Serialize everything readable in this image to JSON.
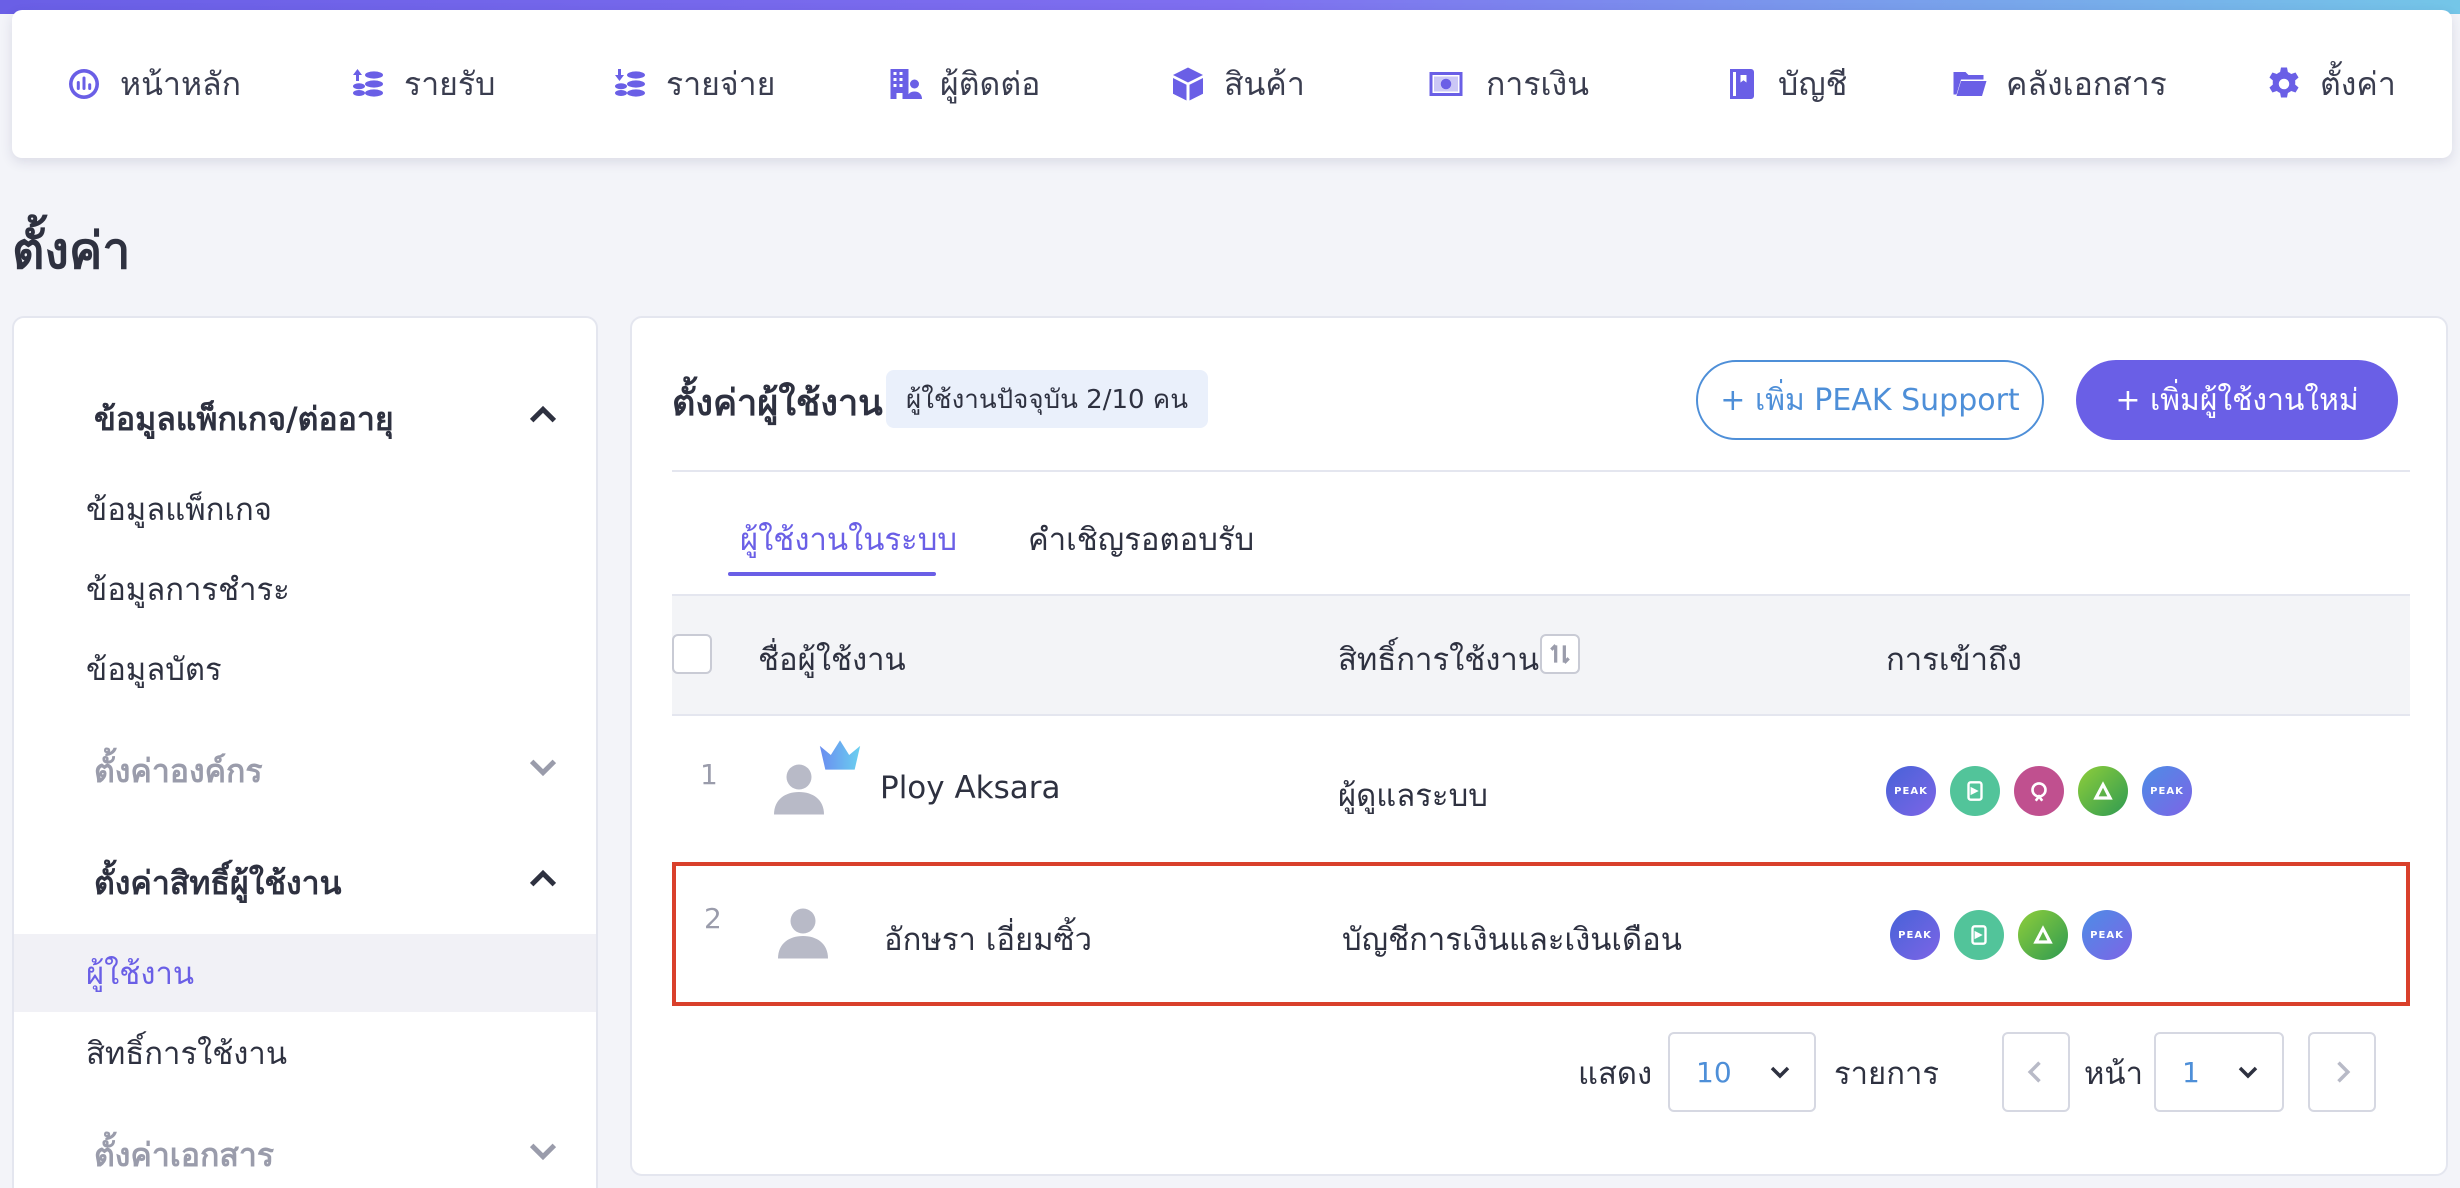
{
  "nav": {
    "items": [
      {
        "label": "หน้าหลัก",
        "icon": "dashboard-icon"
      },
      {
        "label": "รายรับ",
        "icon": "income-coins-icon"
      },
      {
        "label": "รายจ่าย",
        "icon": "expense-coins-icon"
      },
      {
        "label": "ผู้ติดต่อ",
        "icon": "contacts-building-icon"
      },
      {
        "label": "สินค้า",
        "icon": "product-box-icon"
      },
      {
        "label": "การเงิน",
        "icon": "money-icon"
      },
      {
        "label": "บัญชี",
        "icon": "ledger-book-icon"
      },
      {
        "label": "คลังเอกสาร",
        "icon": "folder-icon"
      },
      {
        "label": "ตั้งค่า",
        "icon": "gear-icon"
      }
    ]
  },
  "page_title": "ตั้งค่า",
  "sidebar": {
    "package_header": "ข้อมูลแพ็กเกจ/ต่ออายุ",
    "package_items": [
      "ข้อมูลแพ็กเกจ",
      "ข้อมูลการชำระ",
      "ข้อมูลบัตร"
    ],
    "org_header": "ตั้งค่าองค์กร",
    "user_perm_header": "ตั้งค่าสิทธิ์ผู้ใช้งาน",
    "user_perm_items": [
      "ผู้ใช้งาน",
      "สิทธิ์การใช้งาน"
    ],
    "docs_header": "ตั้งค่าเอกสาร"
  },
  "main": {
    "title": "ตั้งค่าผู้ใช้งาน",
    "user_count": "ผู้ใช้งานปัจจุบัน 2/10 คน",
    "add_support_label": "+ เพิ่ม PEAK Support",
    "add_user_label": "+ เพิ่มผู้ใช้งานใหม่",
    "tabs": [
      "ผู้ใช้งานในระบบ",
      "คำเชิญรอตอบรับ"
    ],
    "columns": {
      "name": "ชื่อผู้ใช้งาน",
      "role": "สิทธิ์การใช้งาน",
      "access": "การเข้าถึง"
    },
    "rows": [
      {
        "num": "1",
        "name": "Ploy Aksara",
        "role": "ผู้ดูแลระบบ",
        "owner": true,
        "access": [
          "peak-app-icon",
          "peak-receipt-icon",
          "peak-link-icon",
          "peak-asset-icon",
          "peak-pos-icon"
        ]
      },
      {
        "num": "2",
        "name": "อักษรา เอี่ยมซิ้ว",
        "role": "บัญชีการเงินและเงินเดือน",
        "owner": false,
        "access": [
          "peak-app-icon",
          "peak-receipt-icon",
          "peak-asset-icon",
          "peak-pos-icon"
        ]
      }
    ],
    "pager": {
      "show_label": "แสดง",
      "page_size": "10",
      "items_label": "รายการ",
      "page_label": "หน้า",
      "page": "1"
    }
  },
  "colors": {
    "accent": "#6a5fe6",
    "link_blue": "#4e8fd8",
    "highlight_border": "#d9402b"
  }
}
